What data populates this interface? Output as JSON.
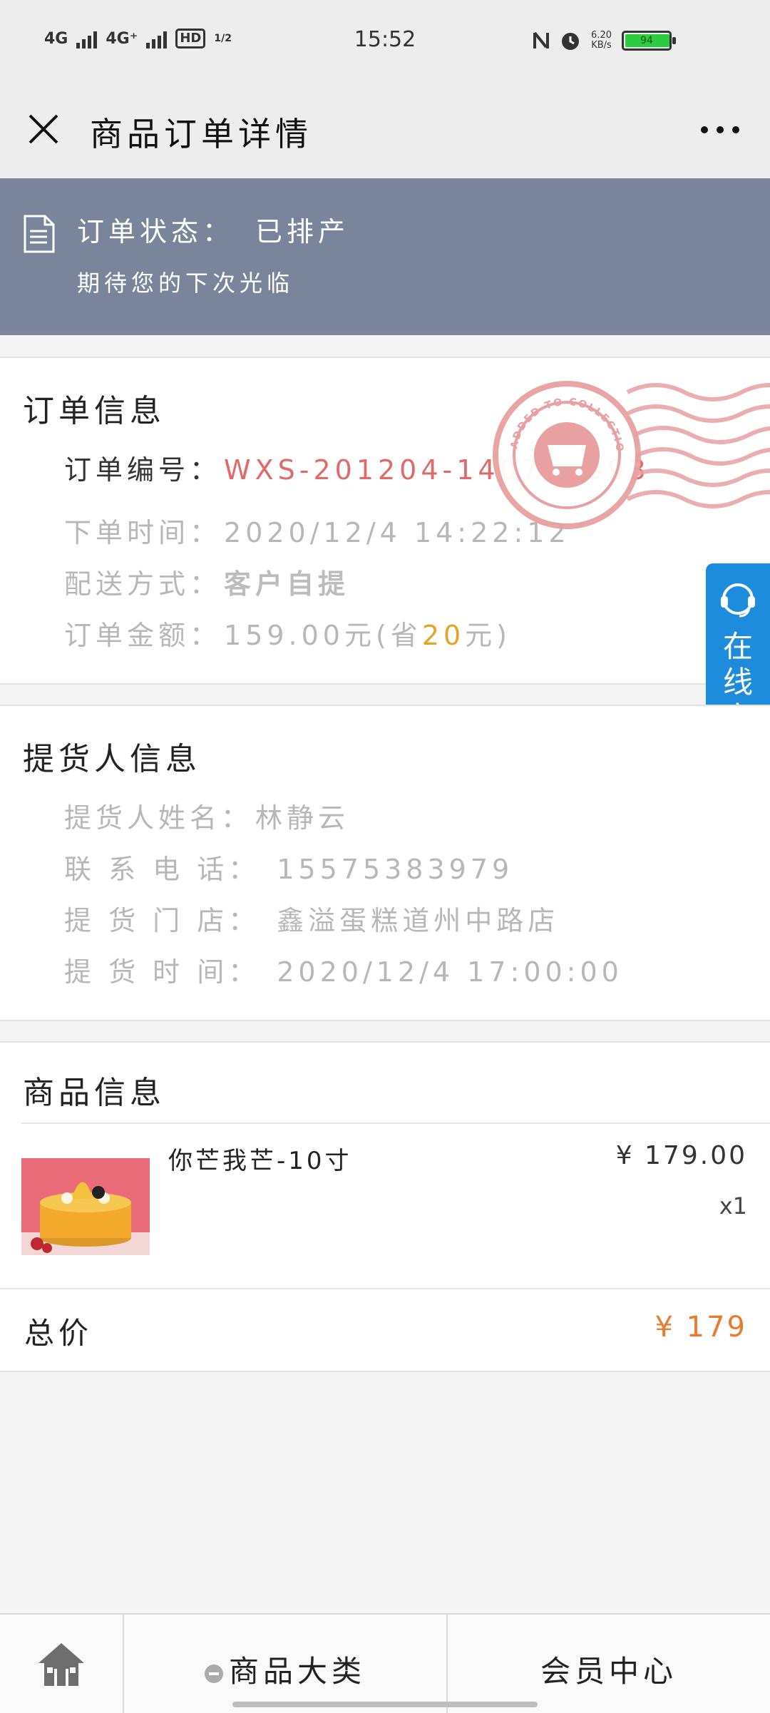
{
  "status_bar": {
    "network_1": "4G",
    "network_2": "4G⁺",
    "hd": "HD",
    "hd_sim": "1/2",
    "time": "15:52",
    "net_speed": "6.20",
    "net_speed_unit": "KB/s",
    "battery": "94"
  },
  "title_bar": {
    "title": "商品订单详情"
  },
  "order_banner": {
    "status_label": "订单状态：",
    "status_value": "已排产",
    "message": "期待您的下次光临"
  },
  "order_info": {
    "title": "订单信息",
    "order_no_label": "订单编号：",
    "order_no": "WXS-201204-140726393",
    "time_label": "下单时间：",
    "time_value": "2020/12/4 14:22:12",
    "delivery_label": "配送方式：",
    "delivery_value": "客户自提",
    "amount_label": "订单金额：",
    "amount_value": "159.00元(省",
    "amount_saved": "20",
    "amount_suffix": "元)"
  },
  "pickup_info": {
    "title": "提货人信息",
    "name_label": "提货人姓名：",
    "name_value": "林静云",
    "phone_label": "联 系 电 话：",
    "phone_value": "15575383979",
    "store_label": "提 货 门 店：",
    "store_value": "鑫溢蛋糕道州中路店",
    "pickup_time_label": "提 货 时 间：",
    "pickup_time_value": "2020/12/4 17:00:00"
  },
  "product_info": {
    "title": "商品信息",
    "items": [
      {
        "name": "你芒我芒-10寸",
        "price": "¥ 179.00",
        "qty": "x1"
      }
    ],
    "total_label": "总价",
    "total_value": "¥ 179"
  },
  "service_tab": {
    "label": "在线客服"
  },
  "stamp": {
    "text": "ADDED TO COLLECTION",
    "color": "#e8a0a0"
  },
  "bottom_nav": {
    "category": "商品大类",
    "member": "会员中心"
  },
  "colors": {
    "banner": "#7a859b",
    "order_no": "#e06a6a",
    "saved": "#e4a42a",
    "total": "#ec7a2c",
    "service": "#1d8cdc"
  }
}
